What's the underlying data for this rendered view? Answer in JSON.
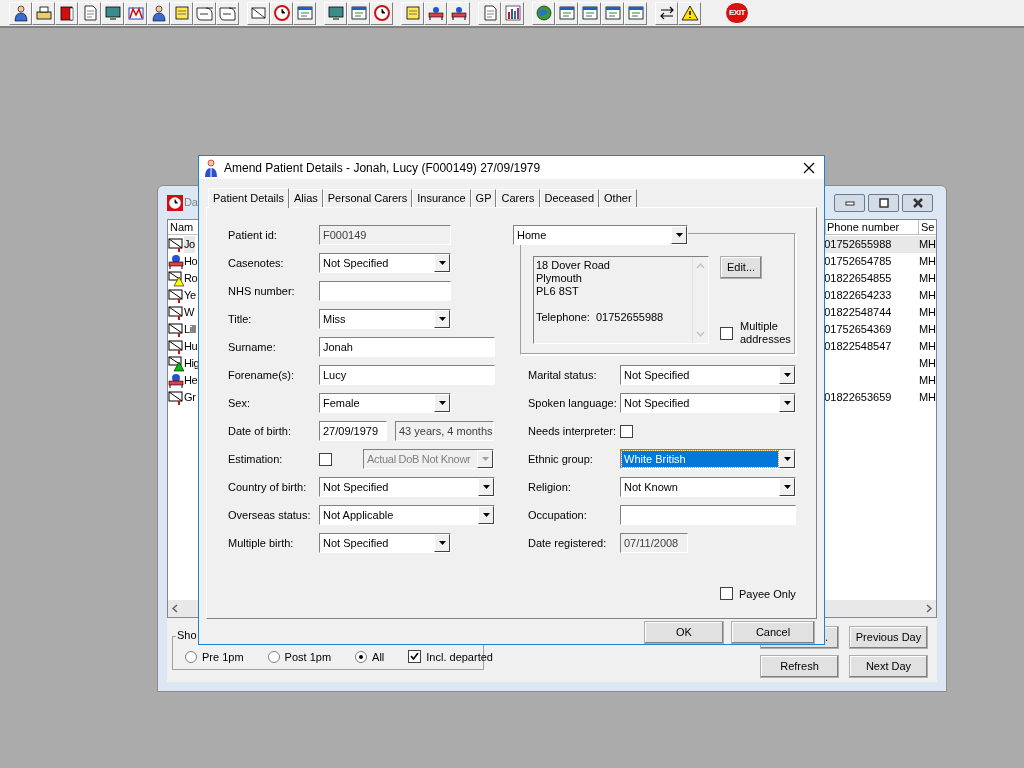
{
  "toolbar": {
    "exit_label": "EXIT"
  },
  "background_window": {
    "title": "Da",
    "columns": [
      "Nam",
      "Phone number",
      "Se"
    ],
    "rows": [
      {
        "name": "Jo",
        "kind": "letter",
        "phone": "01752655988",
        "session": "MH",
        "selected": true
      },
      {
        "name": "Ho",
        "kind": "bed",
        "phone": "01752654785",
        "session": "MH",
        "selected": false
      },
      {
        "name": "Ro",
        "kind": "alert",
        "color": "#ffff00",
        "phone": "01822654855",
        "session": "MH",
        "selected": false
      },
      {
        "name": "Ye",
        "kind": "letter",
        "phone": "01822654233",
        "session": "MH",
        "selected": false
      },
      {
        "name": "W",
        "kind": "letter",
        "phone": "01822548744",
        "session": "MH",
        "selected": false
      },
      {
        "name": "Lill",
        "kind": "letter",
        "phone": "01752654369",
        "session": "MH",
        "selected": false
      },
      {
        "name": "Hu",
        "kind": "letter",
        "phone": "01822548547",
        "session": "MH",
        "selected": false
      },
      {
        "name": "Hig",
        "kind": "alert",
        "color": "#00c000",
        "session": "MH",
        "selected": false
      },
      {
        "name": "He",
        "kind": "bed",
        "session": "MH",
        "selected": false
      },
      {
        "name": "Gr",
        "kind": "letter",
        "phone": "01822653659",
        "session": "MH",
        "selected": false
      }
    ],
    "show_group": {
      "legend": "Sho",
      "radios": [
        {
          "label": "Pre 1pm",
          "selected": false
        },
        {
          "label": "Post 1pm",
          "selected": false
        },
        {
          "label": "All",
          "selected": true
        }
      ],
      "include_departed": {
        "label": "Incl. departed",
        "checked": true
      }
    },
    "buttons": [
      {
        "label": ".",
        "kind": "partial"
      },
      {
        "label": "Previous Day",
        "kind": "previous"
      },
      {
        "label": "Refresh",
        "kind": "refresh"
      },
      {
        "label": "Next Day",
        "kind": "next"
      }
    ]
  },
  "dialog": {
    "title": "Amend Patient Details - Jonah, Lucy (F000149) 27/09/1979",
    "tabs": [
      {
        "label": "Patient Details",
        "selected": true
      },
      {
        "label": "Alias",
        "selected": false
      },
      {
        "label": "Personal Carers",
        "selected": false
      },
      {
        "label": "Insurance",
        "selected": false
      },
      {
        "label": "GP",
        "selected": false
      },
      {
        "label": "Carers",
        "selected": false
      },
      {
        "label": "Deceased",
        "selected": false
      },
      {
        "label": "Other",
        "selected": false
      }
    ],
    "left_fields": [
      {
        "label": "Patient id:",
        "kind": "readonly",
        "value": "F000149",
        "wide": false
      },
      {
        "label": "Casenotes:",
        "kind": "combo",
        "value": "Not Specified",
        "wide": false
      },
      {
        "label": "NHS number:",
        "kind": "text",
        "wide": false
      },
      {
        "label": "Title:",
        "kind": "combo",
        "value": "Miss",
        "wide": false
      },
      {
        "label": "Surname:",
        "kind": "text",
        "value": "Jonah",
        "wide": true
      },
      {
        "label": "Forename(s):",
        "kind": "text",
        "value": "Lucy",
        "wide": true
      },
      {
        "label": "Sex:",
        "kind": "combo",
        "value": "Female",
        "wide": false
      },
      {
        "label": "Date of birth:",
        "kind": "date",
        "value": "27/09/1979",
        "age": "43 years, 4 months"
      },
      {
        "label": "Estimation:",
        "kind": "estimation",
        "checked": false,
        "value": "Actual DoB Not Knowr",
        "disabled": true
      },
      {
        "label": "Country of birth:",
        "kind": "combo",
        "value": "Not Specified",
        "wide": true
      },
      {
        "label": "Overseas status:",
        "kind": "combo",
        "value": "Not Applicable",
        "wide": true
      },
      {
        "label": "Multiple birth:",
        "kind": "combo",
        "value": "Not Specified",
        "wide": false
      }
    ],
    "address": {
      "type": "Home",
      "lines": [
        "18 Dover Road",
        "Plymouth",
        "PL6 8ST"
      ],
      "telephone": "Telephone:  01752655988",
      "edit_button": "Edit...",
      "multiple": {
        "label": "Multiple addresses",
        "checked": false
      }
    },
    "right_fields": [
      {
        "label": "Marital status:",
        "kind": "combo",
        "value": "Not Specified",
        "focused": false
      },
      {
        "label": "Spoken language:",
        "kind": "combo",
        "value": "Not Specified",
        "focused": false
      },
      {
        "label": "Needs interpreter:",
        "kind": "checkbox",
        "checked": false
      },
      {
        "label": "Ethnic group:",
        "kind": "combo",
        "value": "White British",
        "focused": true
      },
      {
        "label": "Religion:",
        "kind": "combo",
        "value": "Not Known",
        "focused": false
      },
      {
        "label": "Occupation:",
        "kind": "text"
      },
      {
        "label": "Date registered:",
        "kind": "readonly",
        "value": "07/11/2008"
      }
    ],
    "payee_only": {
      "label": "Payee Only",
      "checked": false
    },
    "buttons": [
      "OK",
      "Cancel"
    ]
  }
}
